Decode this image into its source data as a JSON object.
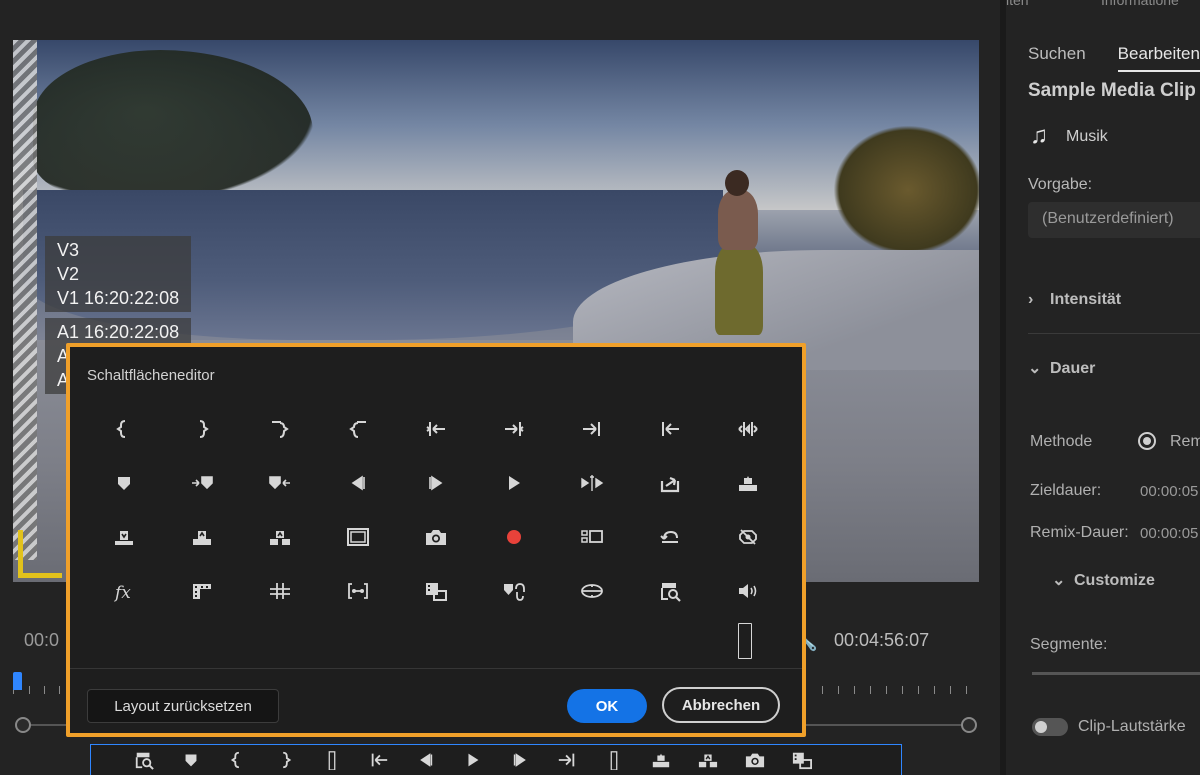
{
  "monitor": {
    "overlay": {
      "video_lines": [
        "V3",
        "V2",
        "V1 16:20:22:08"
      ],
      "audio_lines": [
        "A1 16:20:22:08",
        "A",
        "A"
      ]
    },
    "timecode_left": "00:0",
    "timecode_right": "00:04:56:07",
    "wrench_icon": "wrench-icon"
  },
  "transport_icons": [
    "search-clip-icon",
    "marker-icon",
    "mark-in-icon",
    "mark-out-icon",
    "empty-slot",
    "go-to-in-icon",
    "step-back-icon",
    "play-icon",
    "step-forward-icon",
    "go-to-out-icon",
    "empty-slot",
    "lift-icon",
    "extract-icon",
    "camera-icon",
    "insert-clip-icon",
    "vr-icon"
  ],
  "right_panel": {
    "top_tabs": [
      "iten",
      "Informatione"
    ],
    "tabs": [
      {
        "label": "Suchen",
        "active": false
      },
      {
        "label": "Bearbeiten",
        "active": true
      }
    ],
    "title": "Sample Media Clip",
    "music_label": "Musik",
    "vorgabe_label": "Vorgabe:",
    "preset_value": "(Benutzerdefiniert)",
    "section_intensity": "Intensität",
    "section_duration": "Dauer",
    "method_label": "Methode",
    "method_value": "Rem",
    "target_label": "Zieldauer:",
    "target_value": "00:00:05",
    "remix_label": "Remix-Dauer:",
    "remix_value": "00:00:05",
    "customize_label": "Customize",
    "segments_label": "Segmente:",
    "clip_volume_label": "Clip-Lautstärke"
  },
  "dialog": {
    "title": "Schaltflächeneditor",
    "icons": [
      "mark-in-icon",
      "mark-out-icon",
      "mark-clip-out-icon",
      "mark-clip-in-icon",
      "clear-in-icon",
      "clear-out-icon",
      "go-to-out-icon",
      "go-to-in-icon",
      "clear-in-out-icon",
      "marker-icon",
      "go-to-next-marker-icon",
      "go-to-prev-marker-icon",
      "step-back-icon",
      "step-forward-icon",
      "play-icon",
      "play-in-to-out-icon",
      "export-frame-icon",
      "lift-icon",
      "insert-icon",
      "overwrite-icon",
      "extract-icon",
      "safe-margins-icon",
      "camera-icon",
      "record-icon",
      "multicam-icon",
      "loop-icon",
      "vr-toggle-icon",
      "fx-icon",
      "film-strip-icon",
      "grid-icon",
      "trim-icon",
      "insert-clip-icon",
      "link-icon",
      "comparison-view-icon",
      "search-clip-icon",
      "speaker-icon"
    ],
    "reset_label": "Layout zurücksetzen",
    "ok_label": "OK",
    "cancel_label": "Abbrechen"
  }
}
